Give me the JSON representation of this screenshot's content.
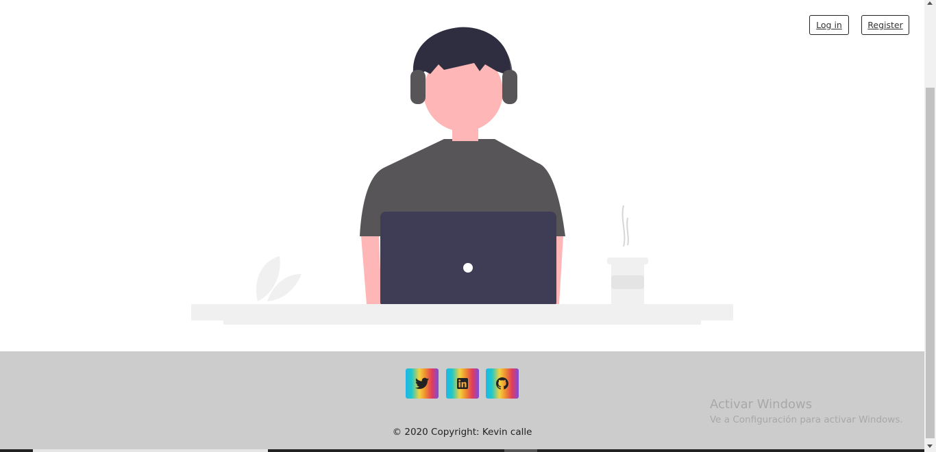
{
  "nav": {
    "login_label": "Log in",
    "register_label": "Register"
  },
  "illustration": {
    "name": "person-with-headphones-at-laptop"
  },
  "footer": {
    "social": [
      {
        "name": "twitter-icon"
      },
      {
        "name": "linkedin-icon"
      },
      {
        "name": "github-icon"
      }
    ],
    "copyright": "© 2020 Copyright: Kevin calle"
  },
  "watermark": {
    "title": "Activar Windows",
    "subtitle": "Ve a Configuración para activar Windows."
  },
  "colors": {
    "footer_bg": "#cccccc",
    "shirt": "#575558",
    "laptop": "#3f3d56",
    "skin": "#ffb6b6",
    "hair": "#2f2e41",
    "desk": "#f0f0f0"
  }
}
